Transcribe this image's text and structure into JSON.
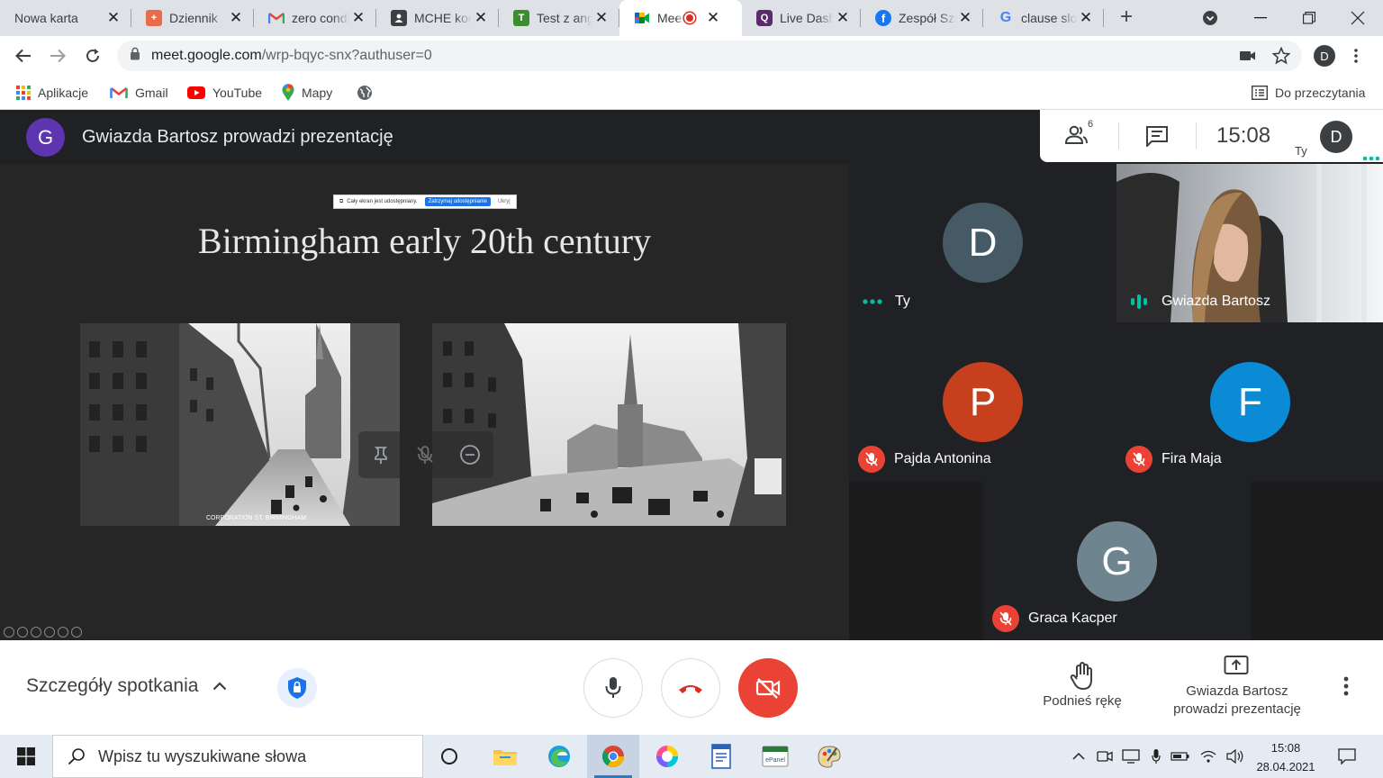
{
  "browser": {
    "tabs": [
      {
        "title": "Nowa karta",
        "icon": "none"
      },
      {
        "title": "Dziennik",
        "icon": "librus-icon",
        "color": "#ea6b4a"
      },
      {
        "title": "zero conditional",
        "icon": "gmail-icon"
      },
      {
        "title": "MCHE kod",
        "icon": "classroom-icon"
      },
      {
        "title": "Test z angielskiego",
        "icon": "testportal-icon",
        "color": "#3c8d2f"
      },
      {
        "title": "Meet",
        "icon": "meet-icon"
      },
      {
        "title": "Live Dashboard",
        "icon": "quizizz-icon"
      },
      {
        "title": "Zespół Szkół",
        "icon": "facebook-icon",
        "color": "#1877f2"
      },
      {
        "title": "clause slowo",
        "icon": "google-icon"
      }
    ],
    "url_host": "meet.google.com",
    "url_path": "/wrp-bqyc-snx?authuser=0",
    "profile_initial": "D"
  },
  "bookmarks": {
    "items": [
      {
        "label": "Aplikacje"
      },
      {
        "label": "Gmail"
      },
      {
        "label": "YouTube"
      },
      {
        "label": "Mapy"
      }
    ],
    "reading_list": "Do przeczytania"
  },
  "meet": {
    "presenter_initial": "G",
    "presenter_bar_title": "Gwiazda Bartosz prowadzi prezentację",
    "participant_count": "6",
    "clock": "15:08",
    "self_label": "Ty",
    "self_initial": "D",
    "slide": {
      "title": "Birmingham early 20th century",
      "share_text": "Cały ekran jest udostępniany.",
      "share_stop": "Zatrzymaj udostępnianie",
      "share_hide": "Ukryj",
      "photo1_caption": "CORPORATION ST, BIRMINGHAM"
    },
    "participants": [
      {
        "name": "Ty",
        "initial": "D",
        "color": "#455a64",
        "state": "speaking-dots"
      },
      {
        "name": "Gwiazda Bartosz",
        "initial": "",
        "state": "speaking-bars"
      },
      {
        "name": "Pajda Antonina",
        "initial": "P",
        "color": "#c6401d",
        "state": "muted"
      },
      {
        "name": "Fira Maja",
        "initial": "F",
        "color": "#0b8bd6",
        "state": "muted"
      },
      {
        "name": "Graca Kacper",
        "initial": "G",
        "color": "#6e8590",
        "state": "muted"
      }
    ]
  },
  "controls": {
    "details": "Szczegóły spotkania",
    "raise_hand": "Podnieś rękę",
    "present_line1": "Gwiazda Bartosz",
    "present_line2": "prowadzi prezentację"
  },
  "taskbar": {
    "search_placeholder": "Wpisz tu wyszukiwane słowa",
    "epanel_label": "ePanel",
    "time": "15:08",
    "date": "28.04.2021"
  }
}
